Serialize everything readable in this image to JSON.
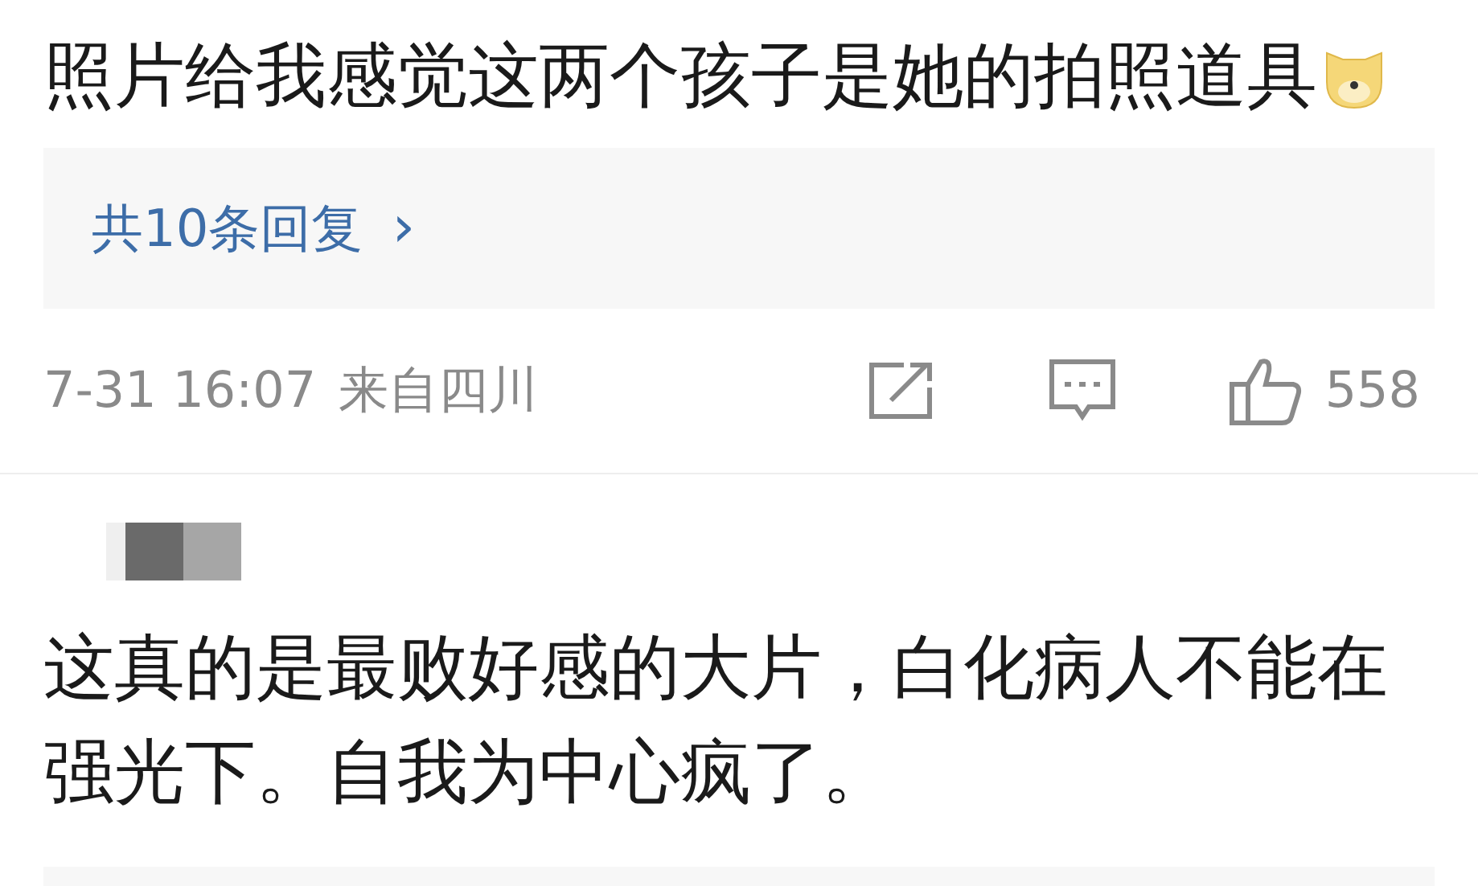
{
  "comment": {
    "text": "照片给我感觉这两个孩子是她的拍照道具"
  },
  "replies": {
    "label": "共10条回复",
    "chevron": "›"
  },
  "meta": {
    "time": "7-31 16:07",
    "location": "来自四川",
    "likes": "558"
  },
  "next_comment": {
    "text": "这真的是最败好感的大片，白化病人不能在强光下。自我为中心疯了。"
  }
}
